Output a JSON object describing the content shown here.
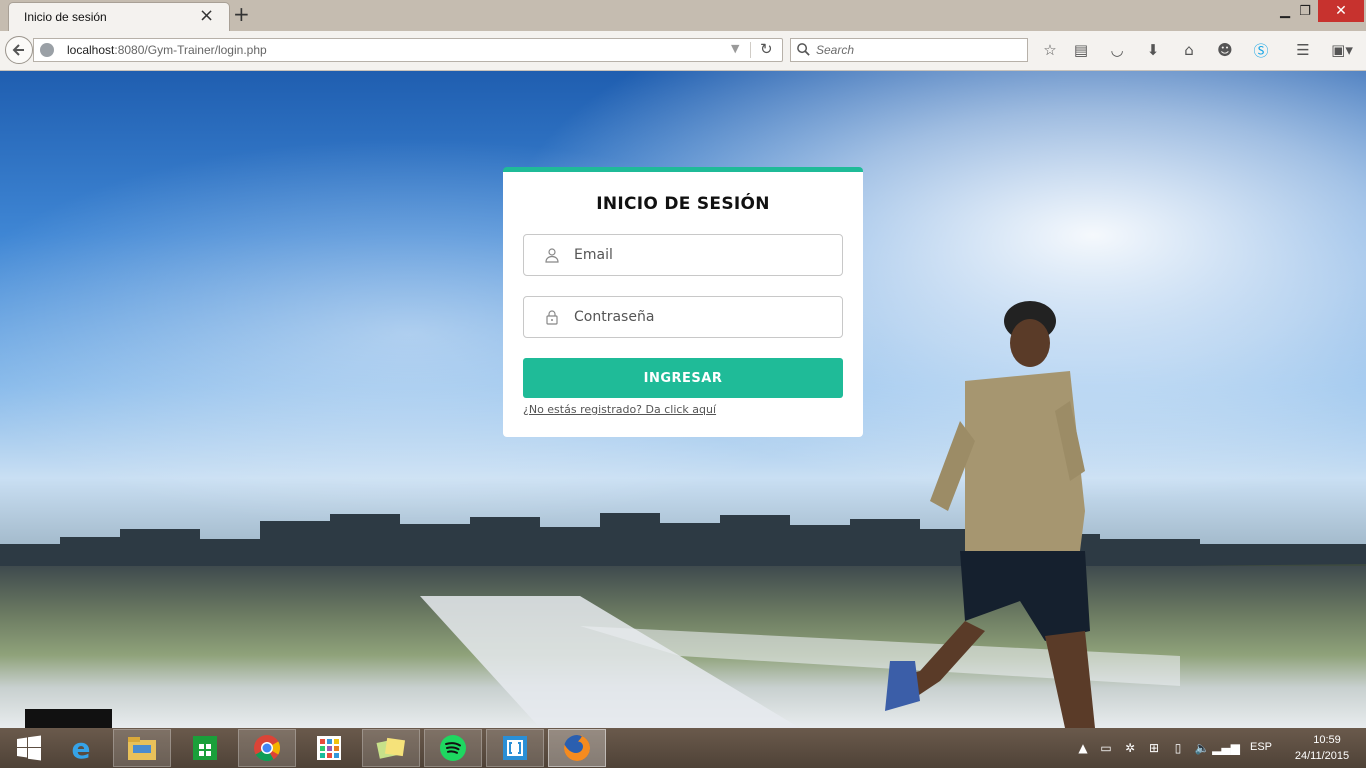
{
  "browser": {
    "tab_title": "Inicio de sesión",
    "url_host": "localhost",
    "url_rest": ":8080/Gym-Trainer/login.php",
    "search_placeholder": "Search"
  },
  "login": {
    "title": "INICIO DE SESIÓN",
    "email_placeholder": "Email",
    "password_placeholder": "Contraseña",
    "submit_label": "INGRESAR",
    "register_link": "¿No estás registrado? Da click aquí"
  },
  "colors": {
    "accent": "#1fbb98",
    "taskbar": "#5a4b3e",
    "close_button": "#c7322e"
  },
  "taskbar": {
    "apps": [
      "start-icon",
      "internet-explorer-icon",
      "file-explorer-icon",
      "windows-store-icon",
      "chrome-icon",
      "apps-grid-icon",
      "sticky-notes-icon",
      "spotify-icon",
      "brackets-icon",
      "firefox-icon"
    ],
    "language": "ESP",
    "time": "10:59",
    "date": "24/11/2015"
  }
}
